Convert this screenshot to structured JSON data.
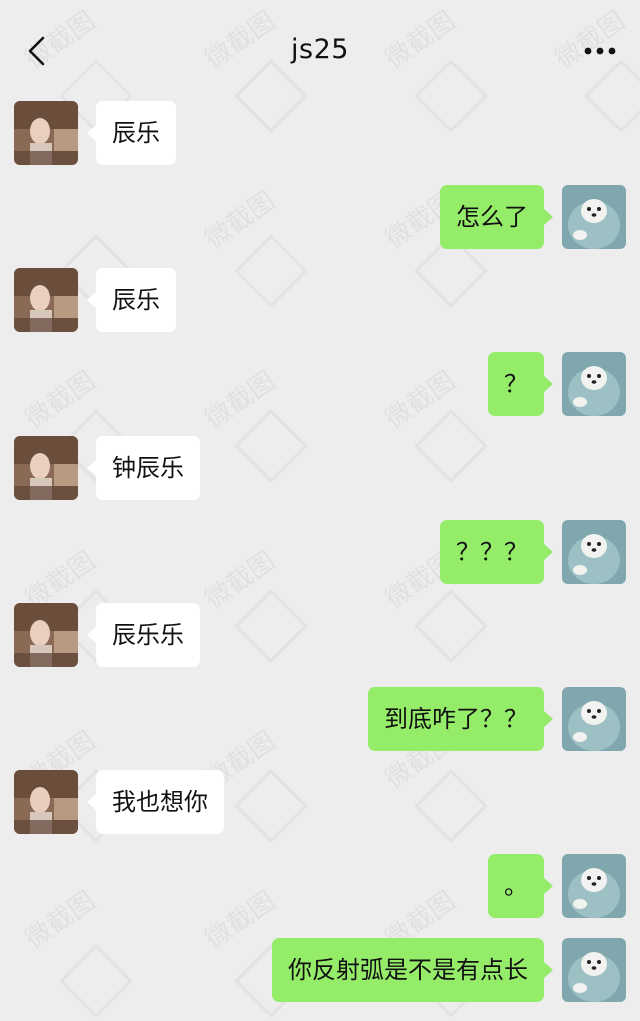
{
  "header": {
    "title": "js25",
    "back_icon": "chevron-left-icon",
    "more_icon": "more-horizontal-icon"
  },
  "watermark_text": "微截图",
  "colors": {
    "background": "#ededed",
    "incoming_bubble": "#ffffff",
    "outgoing_bubble": "#95ec69"
  },
  "messages": [
    {
      "side": "in",
      "text": "辰乐"
    },
    {
      "side": "out",
      "text": "怎么了"
    },
    {
      "side": "in",
      "text": "辰乐"
    },
    {
      "side": "out",
      "text": "？"
    },
    {
      "side": "in",
      "text": "钟辰乐"
    },
    {
      "side": "out",
      "text": "？？？"
    },
    {
      "side": "in",
      "text": "辰乐乐"
    },
    {
      "side": "out",
      "text": "到底咋了？？"
    },
    {
      "side": "in",
      "text": "我也想你"
    },
    {
      "side": "out",
      "text": "。"
    },
    {
      "side": "out",
      "text": "你反射弧是不是有点长"
    }
  ]
}
